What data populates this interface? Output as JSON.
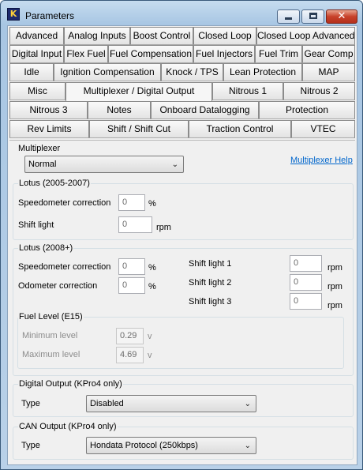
{
  "window": {
    "title": "Parameters",
    "app_icon_glyph": "K",
    "minimize_glyph": "",
    "close_glyph": "✕"
  },
  "tabs": {
    "row1": [
      "Advanced",
      "Analog Inputs",
      "Boost Control",
      "Closed Loop",
      "Closed Loop Advanced"
    ],
    "row2": [
      "Digital Input",
      "Flex Fuel",
      "Fuel Compensation",
      "Fuel Injectors",
      "Fuel Trim",
      "Gear Comp"
    ],
    "row3": [
      "Idle",
      "Ignition Compensation",
      "Knock / TPS",
      "Lean Protection",
      "MAP"
    ],
    "row4": [
      "Misc",
      "Multiplexer / Digital Output",
      "Nitrous 1",
      "Nitrous 2"
    ],
    "row5": [
      "Nitrous 3",
      "Notes",
      "Onboard Datalogging",
      "Protection"
    ],
    "row6": [
      "Rev Limits",
      "Shift / Shift Cut",
      "Traction Control",
      "VTEC"
    ],
    "active": "Multiplexer / Digital Output"
  },
  "multiplexer": {
    "label": "Multiplexer",
    "selected": "Normal",
    "help_link": "Multiplexer Help"
  },
  "lotus_2005": {
    "title": "Lotus (2005-2007)",
    "speedo_label": "Speedometer correction",
    "speedo_value": "0",
    "speedo_unit": "%",
    "shift_label": "Shift light",
    "shift_value": "0",
    "shift_unit": "rpm"
  },
  "lotus_2008": {
    "title": "Lotus (2008+)",
    "speedo_label": "Speedometer correction",
    "speedo_value": "0",
    "speedo_unit": "%",
    "odo_label": "Odometer correction",
    "odo_value": "0",
    "odo_unit": "%",
    "shift1_label": "Shift light 1",
    "shift1_value": "0",
    "shift2_label": "Shift light 2",
    "shift2_value": "0",
    "shift3_label": "Shift light 3",
    "shift3_value": "0",
    "rpm_unit": "rpm",
    "fuel_level": {
      "title": "Fuel Level (E15)",
      "min_label": "Minimum level",
      "min_value": "0.29",
      "max_label": "Maximum level",
      "max_value": "4.69",
      "unit": "v"
    }
  },
  "digital_output": {
    "title": "Digital Output (KPro4 only)",
    "type_label": "Type",
    "selected": "Disabled"
  },
  "can_output": {
    "title": "CAN Output (KPro4 only)",
    "type_label": "Type",
    "selected": "Hondata Protocol (250kbps)"
  }
}
